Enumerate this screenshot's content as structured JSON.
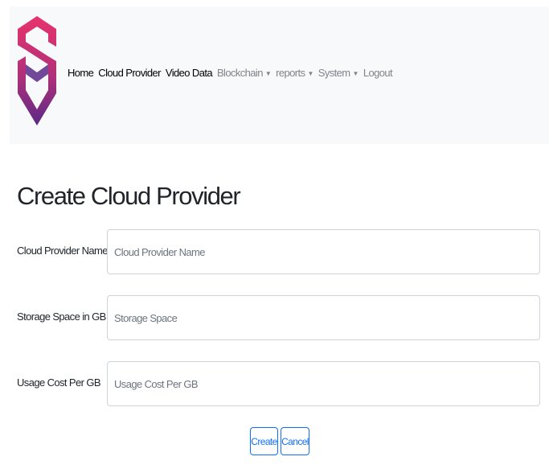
{
  "nav": {
    "items": [
      {
        "label": "Home",
        "style": "active",
        "dropdown": false
      },
      {
        "label": "Cloud Provider",
        "style": "active",
        "dropdown": false
      },
      {
        "label": "Video Data",
        "style": "active",
        "dropdown": false
      },
      {
        "label": "Blockchain",
        "style": "muted",
        "dropdown": true
      },
      {
        "label": "reports",
        "style": "muted",
        "dropdown": true
      },
      {
        "label": "System",
        "style": "muted",
        "dropdown": true
      },
      {
        "label": "Logout",
        "style": "muted",
        "dropdown": false
      }
    ],
    "caret_glyph": "▼"
  },
  "page": {
    "title": "Create Cloud Provider"
  },
  "form": {
    "fields": [
      {
        "label": "Cloud Provider Name",
        "placeholder": "Cloud Provider Name",
        "value": ""
      },
      {
        "label": "Storage Space in GB",
        "placeholder": "Storage Space",
        "value": ""
      },
      {
        "label": "Usage Cost Per GB",
        "placeholder": "Usage Cost Per GB",
        "value": ""
      }
    ],
    "buttons": {
      "create": "Create",
      "cancel": "Cancel"
    }
  },
  "colors": {
    "navbar_bg": "#f8f9fa",
    "brand_pink": "#e5336f",
    "brand_purple": "#5b2a86",
    "button_primary": "#0d6efd"
  }
}
